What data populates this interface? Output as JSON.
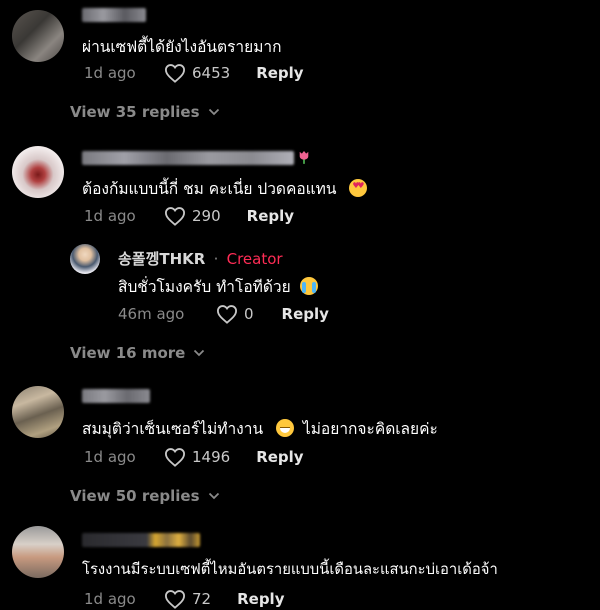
{
  "colors": {
    "background": "#000000",
    "creator_accent": "#fe2c55",
    "muted_text": "#8a8a8a"
  },
  "comments": [
    {
      "text": "ผ่านเซฟตี้ได้ยังไงอันตรายมาก",
      "time": "1d ago",
      "likes": "6453",
      "reply_label": "Reply",
      "view_replies": "View 35 replies"
    },
    {
      "text": "ต้องก้มแบบนี้กี่ ชม คะเนี่ย ปวดคอแทน",
      "emoji": "smiling-face-with-hearts",
      "time": "1d ago",
      "likes": "290",
      "reply_label": "Reply",
      "reply": {
        "username": "송폴껭THKR",
        "separator": "·",
        "badge": "Creator",
        "text": "สิบชั่วโมงครับ ทำโอทีด้วย",
        "emoji": "loudly-crying-face",
        "time": "46m ago",
        "likes": "0",
        "reply_label": "Reply"
      },
      "view_replies": "View 16 more"
    },
    {
      "text": "สมมุติว่าเซ็นเซอร์ไม่ทำงาน",
      "emoji": "grinning-face-with-sweat",
      "text_after_emoji": "ไม่อยากจะคิดเลยค่ะ",
      "time": "1d ago",
      "likes": "1496",
      "reply_label": "Reply",
      "view_replies": "View 50 replies"
    },
    {
      "text": "โรงงานมีระบบเซฟตี้ไหมอันตรายแบบนี้เดือนละแสนกะบ่เอาเด้อจ้า",
      "time": "1d ago",
      "likes": "72",
      "reply_label": "Reply"
    }
  ]
}
